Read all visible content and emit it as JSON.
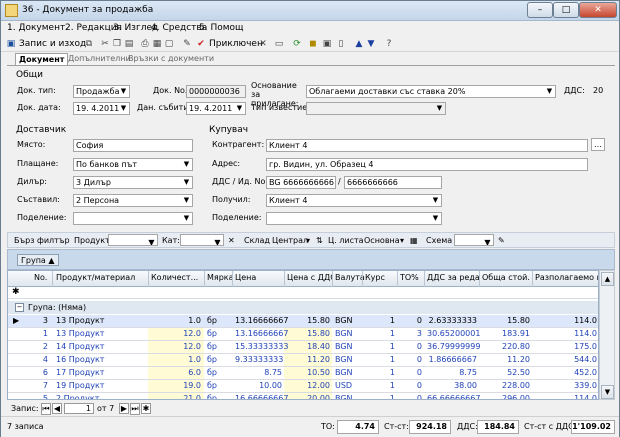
{
  "window": {
    "title": "36 - Документ за продажба"
  },
  "menu": [
    "1. Документ",
    "2. Редакция",
    "3. Изглед",
    "4. Средства",
    "5. Помощ"
  ],
  "toolbar": {
    "save_close": "Запис и изход",
    "post": "Приключен"
  },
  "tabs": [
    "Документ",
    "Допълнителни",
    "Връзки с документи"
  ],
  "general": {
    "section": "Общи",
    "doc_type_label": "Док. тип:",
    "doc_type": "Продажба",
    "doc_no_label": "Док. No.",
    "doc_no": "0000000036",
    "basis_label": "Основание за прилагане:",
    "basis": "Облагаеми доставки със ставка 20%",
    "vat_label": "ДДС:",
    "vat": "20",
    "doc_date_label": "Док. дата:",
    "doc_date": "19. 4.2011",
    "event_date_label": "Дан. събитие:",
    "event_date": "19. 4.2011",
    "notice_label": "Тип известие:"
  },
  "supplier": {
    "section": "Доставчик",
    "place_label": "Място:",
    "place": "София",
    "payment_label": "Плащане:",
    "payment": "По банков път",
    "dealer_label": "Дилър:",
    "dealer": "3 Дилър",
    "composer_label": "Съставил:",
    "composer": "2 Персона",
    "division_label": "Поделение:"
  },
  "buyer": {
    "section": "Купувач",
    "contractor_label": "Контрагент:",
    "contractor": "Клиент 4",
    "address_label": "Адрес:",
    "address": "гр. Видин, ул. Образец 4",
    "vat_id_label": "ДДС / Ид. No.",
    "vat_no": "BG 6666666666",
    "id_no": "6666666666",
    "receiver_label": "Получил:",
    "receiver": "Клиент 4",
    "division_label": "Поделение:"
  },
  "gridbar": {
    "quick_filter": "Бърз филтър",
    "product": "Продукт:",
    "cat": "Кат:",
    "warehouse": "Склад",
    "warehouse_val": "Централ",
    "price_list": "Ц. листа",
    "price_list_val": "Основна",
    "scheme": "Схема"
  },
  "group_btn": "Група",
  "columns": [
    "No.",
    "Продукт/материал",
    "Количест...",
    "Мярка",
    "Цена",
    "Цена с ДДС",
    "Валута",
    "Курс",
    "ТО%",
    "ДДС за реда",
    "Обща стой...",
    "Разполагаемо кол."
  ],
  "group_row": "Група: (Няма)",
  "rows": [
    {
      "no": "3",
      "product": "13 Продукт",
      "qty": "1.0",
      "unit": "бр",
      "price": "13.16666667",
      "price_vat": "15.80",
      "cur": "BGN",
      "rate": "1",
      "to": "0",
      "vat_row": "2.63333333",
      "total": "15.80",
      "avail": "114.0"
    },
    {
      "no": "1",
      "product": "13 Продукт",
      "qty": "12.0",
      "unit": "бр",
      "price": "13.16666667",
      "price_vat": "15.80",
      "cur": "BGN",
      "rate": "1",
      "to": "3",
      "vat_row": "30.65200001",
      "total": "183.91",
      "avail": "114.0"
    },
    {
      "no": "2",
      "product": "14 Продукт",
      "qty": "12.0",
      "unit": "бр",
      "price": "15.33333333",
      "price_vat": "18.40",
      "cur": "BGN",
      "rate": "1",
      "to": "0",
      "vat_row": "36.79999999",
      "total": "220.80",
      "avail": "175.0"
    },
    {
      "no": "4",
      "product": "16 Продукт",
      "qty": "1.0",
      "unit": "бр",
      "price": "9.33333333",
      "price_vat": "11.20",
      "cur": "BGN",
      "rate": "1",
      "to": "0",
      "vat_row": "1.86666667",
      "total": "11.20",
      "avail": "544.0"
    },
    {
      "no": "6",
      "product": "17 Продукт",
      "qty": "6.0",
      "unit": "бр",
      "price": "8.75",
      "price_vat": "10.50",
      "cur": "BGN",
      "rate": "1",
      "to": "0",
      "vat_row": "8.75",
      "total": "52.50",
      "avail": "452.0"
    },
    {
      "no": "7",
      "product": "19 Продукт",
      "qty": "19.0",
      "unit": "бр",
      "price": "10.00",
      "price_vat": "12.00",
      "cur": "USD",
      "rate": "1",
      "to": "0",
      "vat_row": "38.00",
      "total": "228.00",
      "avail": "339.0"
    },
    {
      "no": "5",
      "product": "2 Продукт",
      "qty": "21.0",
      "unit": "бр",
      "price": "16.66666667",
      "price_vat": "20.00",
      "cur": "BGN",
      "rate": "1",
      "to": "0",
      "vat_row": "66.66666667",
      "total": "296.00",
      "avail": "114.0"
    }
  ],
  "nav": {
    "label": "Запис:",
    "current": "1",
    "of": "от 7"
  },
  "status": {
    "records": "7 записа",
    "to_label": "ТО:",
    "to": "4.74",
    "cost_label": "Ст-ст:",
    "cost": "924.18",
    "vat_label": "ДДС:",
    "vat": "184.84",
    "cost_vat_label": "Ст-ст с ДДС:",
    "cost_vat": "1'109.02"
  }
}
